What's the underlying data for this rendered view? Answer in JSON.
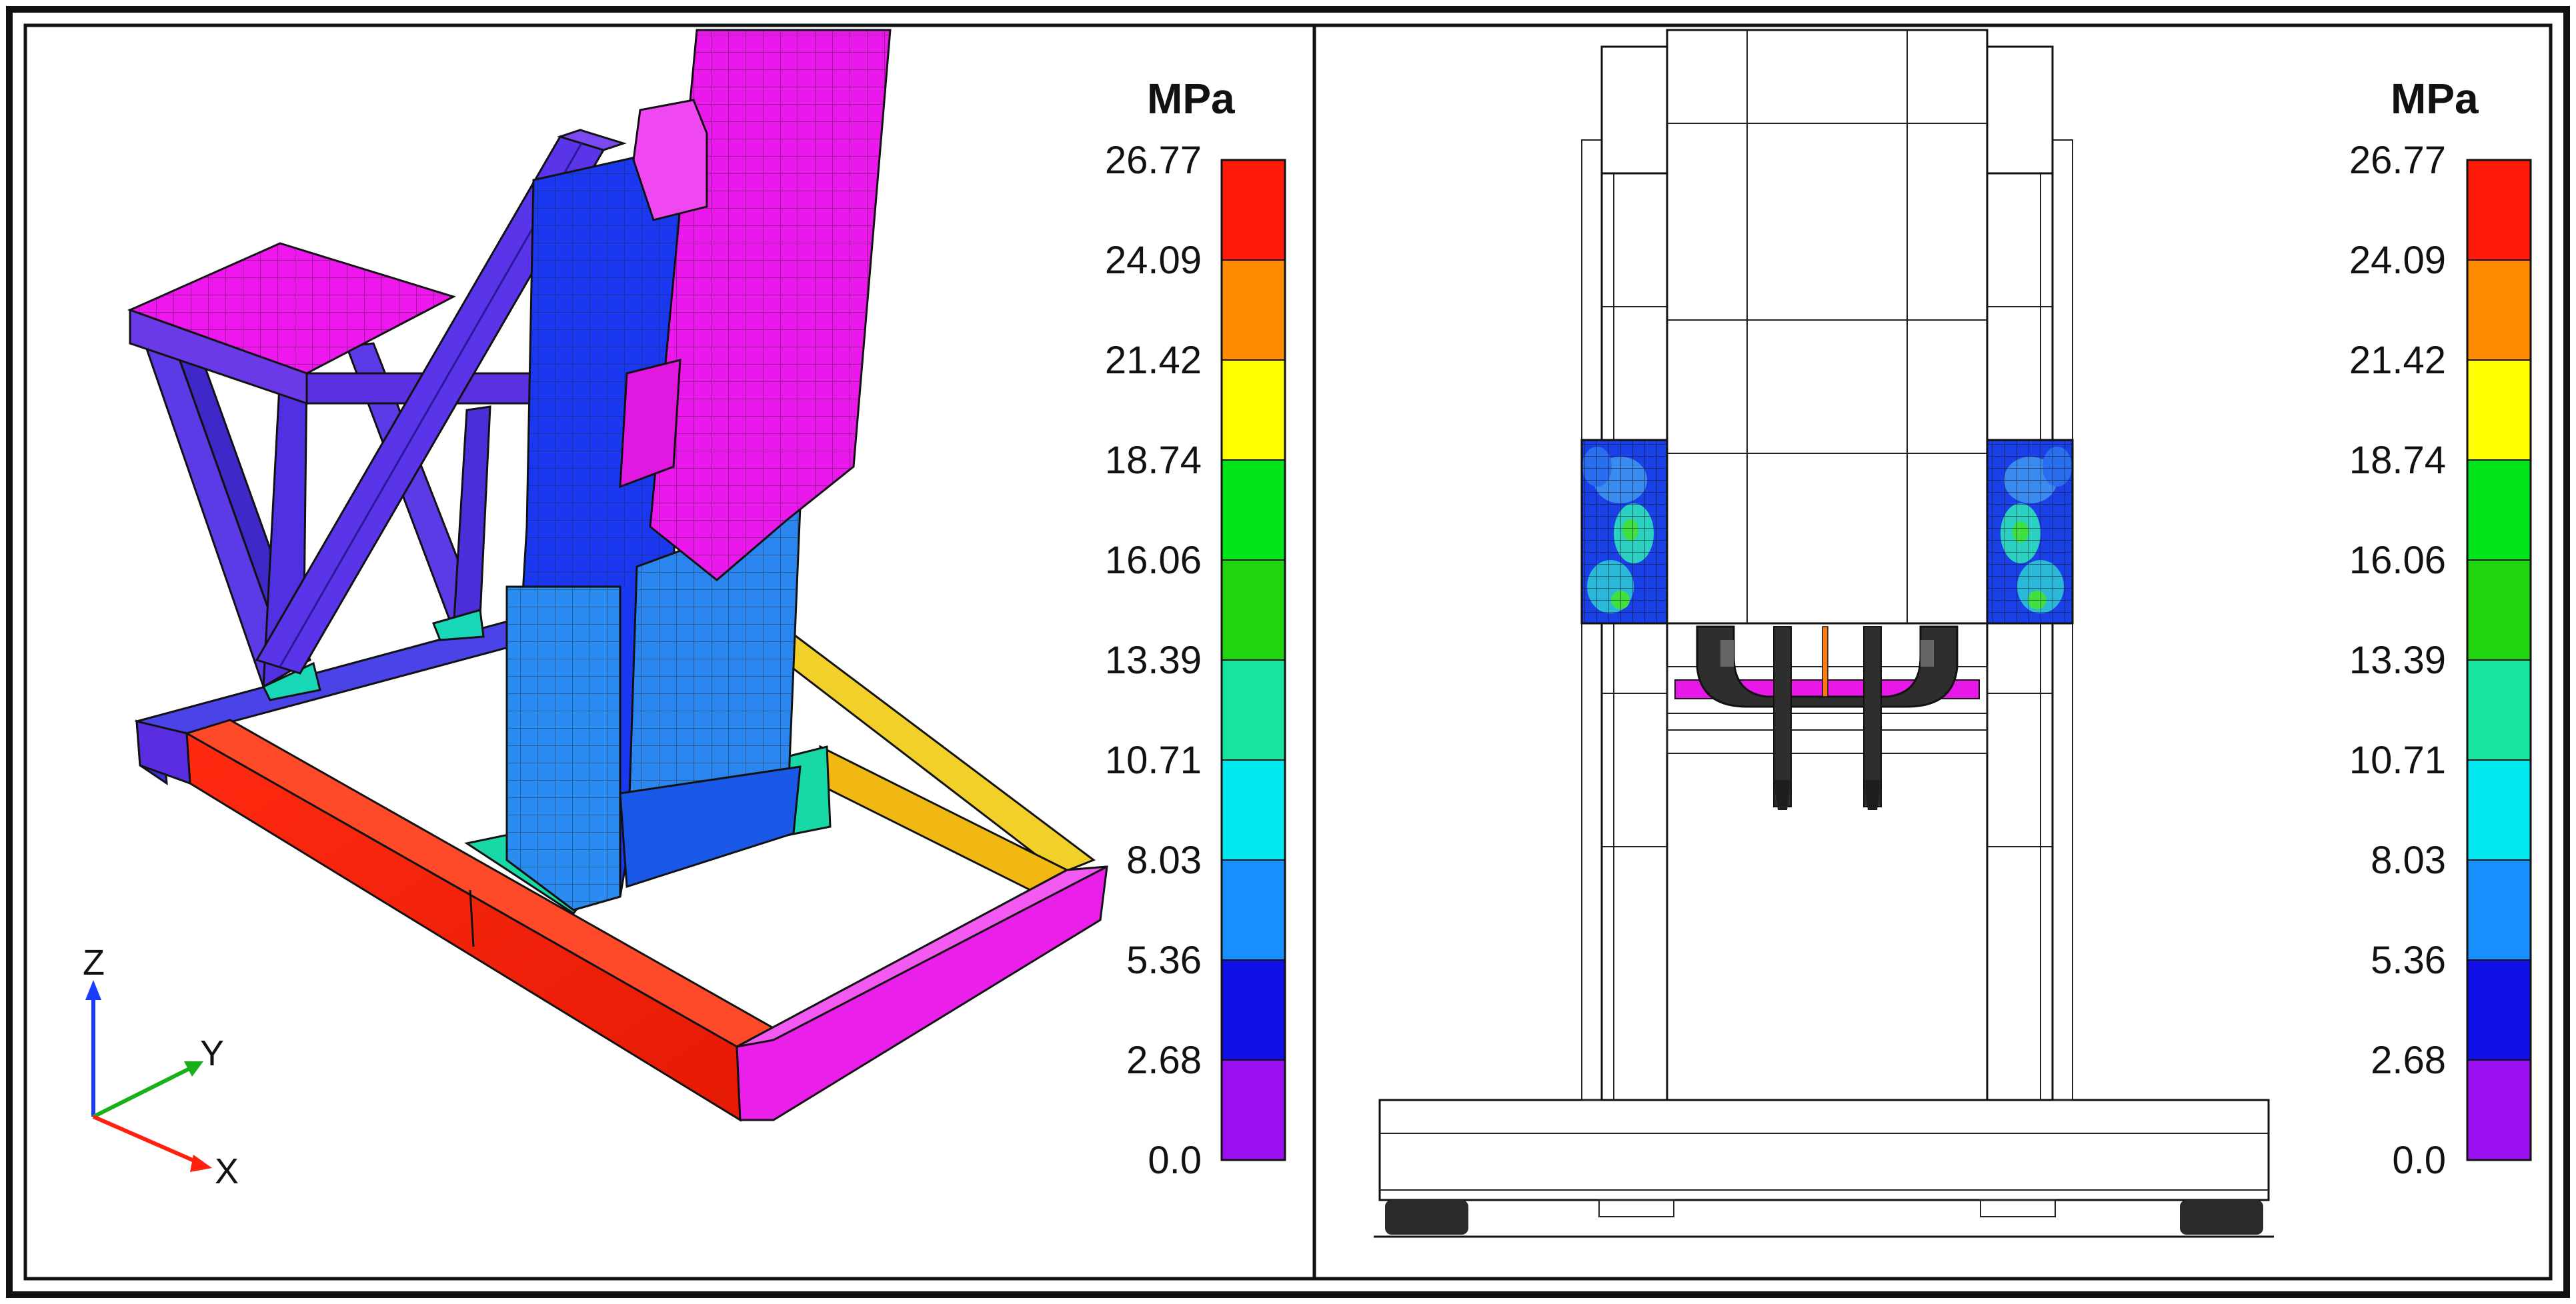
{
  "left_panel": {
    "unit": "MPa",
    "scale_ticks": [
      "26.77",
      "24.09",
      "21.42",
      "18.74",
      "16.06",
      "13.39",
      "10.71",
      "8.03",
      "5.36",
      "2.68",
      "0.0"
    ],
    "axes": {
      "z": "Z",
      "y": "Y",
      "x": "X"
    }
  },
  "right_panel": {
    "unit": "MPa",
    "scale_ticks": [
      "26.77",
      "24.09",
      "21.42",
      "18.74",
      "16.06",
      "13.39",
      "10.71",
      "8.03",
      "5.36",
      "2.68",
      "0.0"
    ]
  },
  "colors": {
    "scale_bands_top_to_bottom": [
      "#ff1a0a",
      "#ff8c00",
      "#ffff00",
      "#00e61a",
      "#22d410",
      "#18e6a0",
      "#00e8f0",
      "#1890ff",
      "#1010e6",
      "#9a10f0"
    ],
    "magenta": "#ee10ee",
    "violet": "#5a20e0",
    "blue": "#1a3cf0",
    "light_blue": "#2a8cf0",
    "red": "#ff1a0a",
    "yellow": "#f0c420",
    "teal": "#18d8a8"
  }
}
